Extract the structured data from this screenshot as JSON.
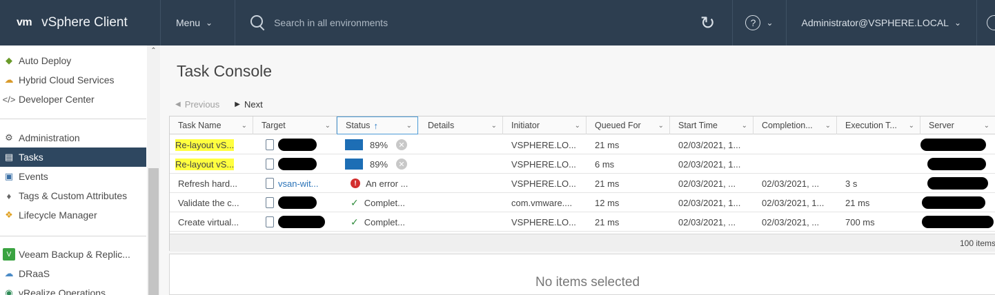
{
  "header": {
    "logo": "vm",
    "title": "vSphere Client",
    "menu_label": "Menu",
    "search_placeholder": "Search in all environments",
    "user": "Administrator@VSPHERE.LOCAL"
  },
  "sidebar": {
    "items": [
      {
        "label": "Auto Deploy",
        "icon": "auto-deploy-icon"
      },
      {
        "label": "Hybrid Cloud Services",
        "icon": "cloud-icon"
      },
      {
        "label": "Developer Center",
        "icon": "code-icon"
      },
      {
        "label": "Administration",
        "icon": "gears-icon"
      },
      {
        "label": "Tasks",
        "icon": "clipboard-icon",
        "active": true
      },
      {
        "label": "Events",
        "icon": "events-icon"
      },
      {
        "label": "Tags & Custom Attributes",
        "icon": "tag-icon"
      },
      {
        "label": "Lifecycle Manager",
        "icon": "lifecycle-icon"
      },
      {
        "label": "Veeam Backup & Replic...",
        "icon": "veeam-icon"
      },
      {
        "label": "DRaaS",
        "icon": "draas-icon"
      },
      {
        "label": "vRealize Operations",
        "icon": "vrops-icon"
      }
    ]
  },
  "main": {
    "title": "Task Console",
    "pager": {
      "previous": "Previous",
      "next": "Next"
    },
    "columns": [
      "Task Name",
      "Target",
      "Status",
      "Details",
      "Initiator",
      "Queued For",
      "Start Time",
      "Completion...",
      "Execution T...",
      "Server"
    ],
    "rows": [
      {
        "task": "Re-layout vS...",
        "target": "",
        "status": "89%",
        "status_type": "progress",
        "progress": 0.89,
        "details": "",
        "initiator": "VSPHERE.LO...",
        "queued": "21 ms",
        "start": "02/03/2021, 1...",
        "completion": "",
        "execution": ""
      },
      {
        "task": "Re-layout vS...",
        "target": "",
        "status": "89%",
        "status_type": "progress",
        "progress": 0.89,
        "details": "",
        "initiator": "VSPHERE.LO...",
        "queued": "6 ms",
        "start": "02/03/2021, 1...",
        "completion": "",
        "execution": ""
      },
      {
        "task": "Refresh hard...",
        "target": "vsan-wit...",
        "status": "An error ...",
        "status_type": "error",
        "details": "",
        "initiator": "VSPHERE.LO...",
        "queued": "21 ms",
        "start": "02/03/2021, ...",
        "completion": "02/03/2021, ...",
        "execution": "3 s"
      },
      {
        "task": "Validate the c...",
        "target": "",
        "status": "Complet...",
        "status_type": "ok",
        "details": "",
        "initiator": "com.vmware....",
        "queued": "12 ms",
        "start": "02/03/2021, 1...",
        "completion": "02/03/2021, 1...",
        "execution": "21 ms"
      },
      {
        "task": "Create virtual...",
        "target": "",
        "status": "Complet...",
        "status_type": "ok",
        "details": "",
        "initiator": "VSPHERE.LO...",
        "queued": "21 ms",
        "start": "02/03/2021, ...",
        "completion": "02/03/2021, ...",
        "execution": "700 ms"
      }
    ],
    "footer_count": "100 items",
    "detail_empty": "No items selected"
  }
}
